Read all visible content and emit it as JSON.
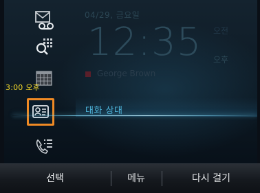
{
  "status": {
    "date": "04/29, 금요일",
    "time": "12:35",
    "am_label": "오전",
    "pm_label": "오후",
    "contact_name": "George Brown"
  },
  "sidebar": {
    "time_label": "3:00 오후",
    "icons": [
      "voicemail-icon",
      "dialpad-search-icon",
      "calendar-icon",
      "contact-card-icon",
      "call-list-icon"
    ],
    "selected_label": "대화 상대",
    "accent_color": "#f08a24"
  },
  "softkeys": {
    "select": "선택",
    "menu": "메뉴",
    "redial": "다시 걸기"
  }
}
